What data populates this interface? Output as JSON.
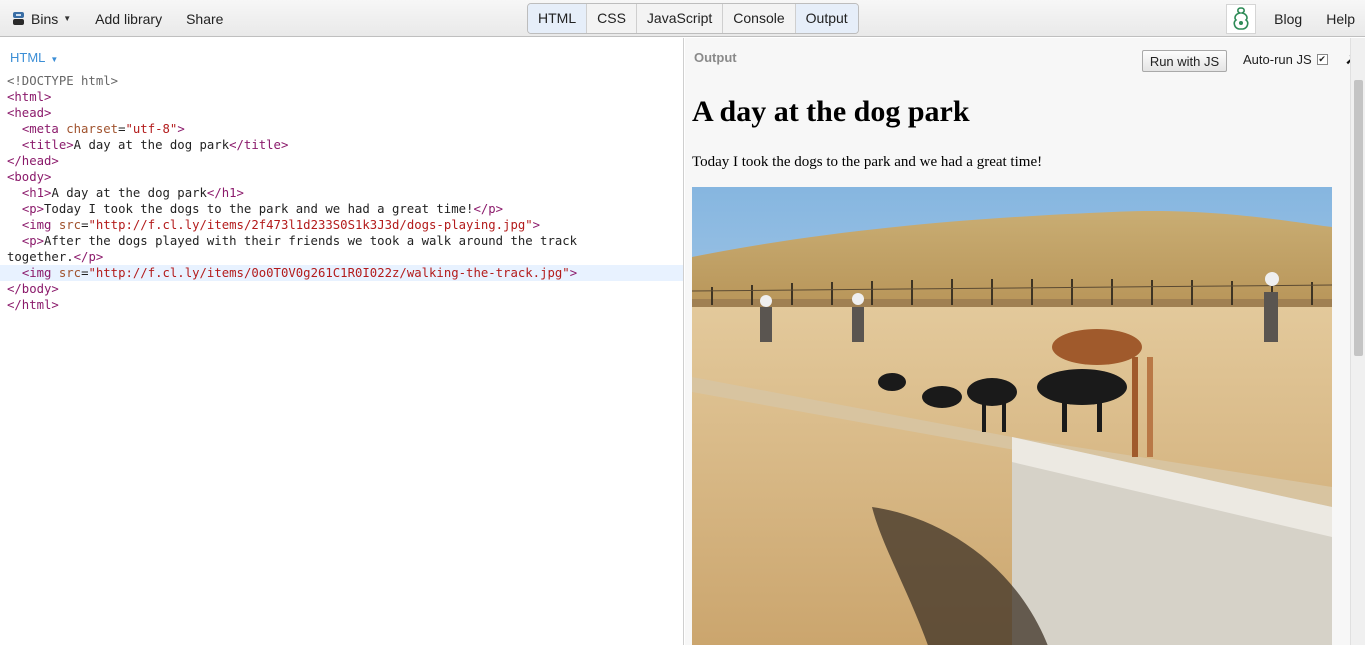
{
  "toolbar": {
    "bins_label": "Bins",
    "add_library": "Add library",
    "share": "Share",
    "blog": "Blog",
    "help": "Help",
    "logo_icon": "jsbin-logo-icon"
  },
  "tabs": [
    {
      "label": "HTML",
      "active": true
    },
    {
      "label": "CSS",
      "active": false
    },
    {
      "label": "JavaScript",
      "active": false
    },
    {
      "label": "Console",
      "active": false
    },
    {
      "label": "Output",
      "active": true
    }
  ],
  "editor": {
    "panel_label": "HTML",
    "code_lines": [
      "<!DOCTYPE html>",
      "<html>",
      "<head>",
      "  <meta charset=\"utf-8\">",
      "  <title>A day at the dog park</title>",
      "</head>",
      "<body>",
      "  <h1>A day at the dog park</h1>",
      "  <p>Today I took the dogs to the park and we had a great time!</p>",
      "  <img src=\"http://f.cl.ly/items/2f473l1d233S0S1k3J3d/dogs-playing.jpg\">",
      "  <p>After the dogs played with their friends we took a walk around the track",
      "together.</p>",
      "  <img src=\"http://f.cl.ly/items/0o0T0V0g261C1R0I022z/walking-the-track.jpg\">",
      "</body>",
      "</html>"
    ]
  },
  "output": {
    "panel_label": "Output",
    "run_button": "Run with JS",
    "autorun_label": "Auto-run JS",
    "autorun_checked": true,
    "heading": "A day at the dog park",
    "paragraph": "Today I took the dogs to the park and we had a great time!",
    "image_icon": "dogs-playing-photo"
  }
}
